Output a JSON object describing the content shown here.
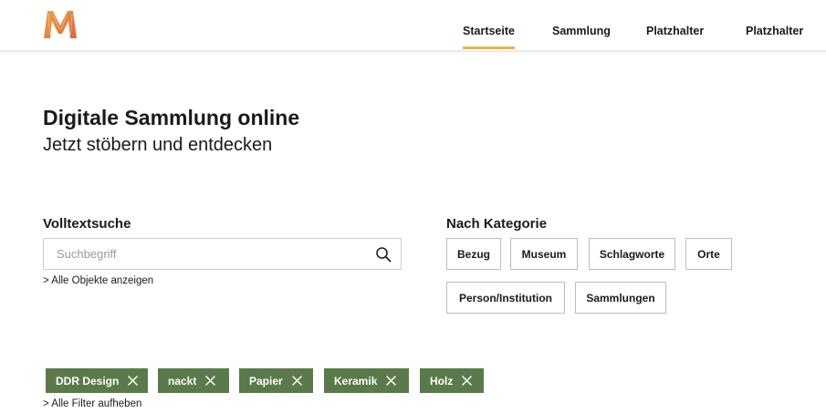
{
  "header": {
    "logo_letter": "M",
    "nav": [
      {
        "label": "Startseite",
        "active": true
      },
      {
        "label": "Sammlung",
        "active": false
      },
      {
        "label": "Platzhalter",
        "active": false
      },
      {
        "label": "Platzhalter",
        "active": false
      }
    ],
    "active_underline_color": "#e8b34c"
  },
  "main": {
    "title": "Digitale Sammlung online",
    "subtitle": "Jetzt stöbern und entdecken"
  },
  "fulltext": {
    "label": "Volltextsuche",
    "placeholder": "Suchbegriff",
    "value": "",
    "icon": "search-icon",
    "show_all_link": "> Alle Objekte anzeigen"
  },
  "categories": {
    "label": "Nach Kategorie",
    "items": [
      "Bezug",
      "Museum",
      "Schlagworte",
      "Orte",
      "Person/Institution",
      "Sammlungen"
    ]
  },
  "filters": {
    "chip_color": "#5a7a4a",
    "chips": [
      "DDR Design",
      "nackt",
      "Papier",
      "Keramik",
      "Holz"
    ],
    "remove_icon": "close-icon",
    "clear_link": "> Alle Filter aufheben"
  }
}
